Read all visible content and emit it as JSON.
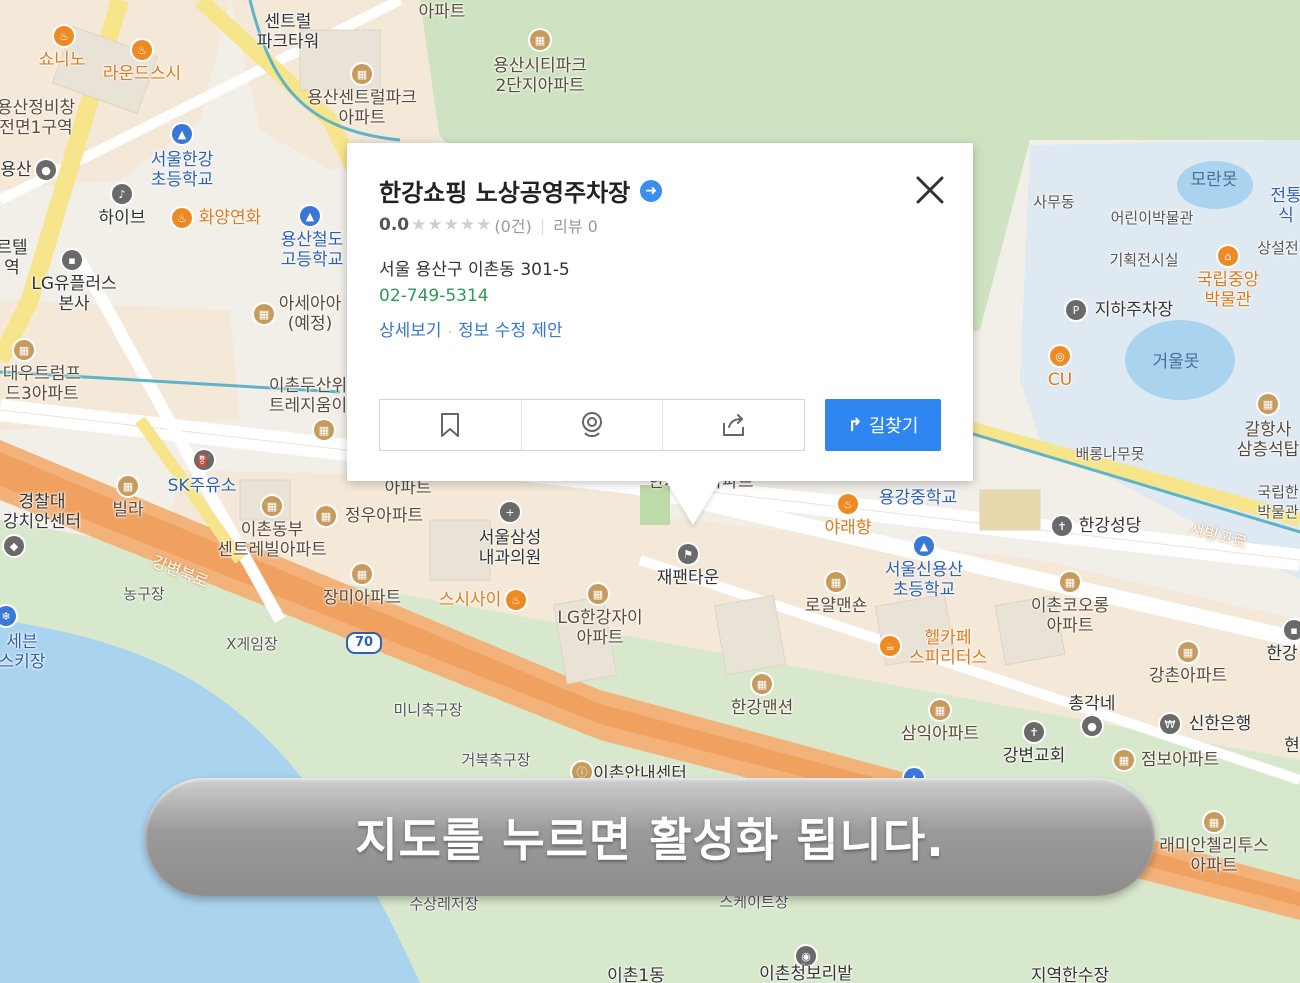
{
  "popup": {
    "title": "한강쇼핑 노상공영주차장",
    "rating_score": "0.0",
    "rating_stars": "★★★★★",
    "rating_count": "(0건)",
    "review_text": "리뷰 0",
    "address": "서울 용산구 이촌동 301-5",
    "phone": "02-749-5314",
    "link_detail": "상세보기",
    "link_separator": ".",
    "link_edit": "정보 수정 제안",
    "route_label": "길찾기",
    "icons": [
      "bookmark-icon",
      "roadview-icon",
      "share-icon",
      "route-arrow-icon",
      "close-icon",
      "go-arrow-icon"
    ],
    "accent_color": "#2f86f0",
    "phone_color": "#2d9a58"
  },
  "banner": {
    "text": "지도를 누르면 활성화 됩니다."
  },
  "map": {
    "highway_number": "70",
    "labels": [
      {
        "text": "센트럴\n파크타워",
        "style": ""
      },
      {
        "text": "아파트",
        "style": "poi-brown"
      },
      {
        "text": "쇼니노",
        "style": "poi-orange"
      },
      {
        "text": "라운드스시",
        "style": "poi-orange"
      },
      {
        "text": "용산시티파크\n2단지아파트",
        "style": "poi-brown"
      },
      {
        "text": "용산센트럴파크\n아파트",
        "style": "poi-brown"
      },
      {
        "text": "용산정비창\n전면1구역",
        "style": "poi-brown"
      },
      {
        "text": "서울한강\n초등학교",
        "style": "poi-blue"
      },
      {
        "text": "용산",
        "style": ""
      },
      {
        "text": "하이브",
        "style": ""
      },
      {
        "text": "화양연화",
        "style": "poi-orange"
      },
      {
        "text": "용산철도\n고등학교",
        "style": "poi-blue"
      },
      {
        "text": "LG유플러스\n본사",
        "style": ""
      },
      {
        "text": "르텔\n역",
        "style": ""
      },
      {
        "text": "아세아아\n(예정)",
        "style": "poi-brown"
      },
      {
        "text": "대우트럼프\n드3아파트",
        "style": "poi-brown"
      },
      {
        "text": "이촌두산위\n트레지움이",
        "style": "poi-brown"
      },
      {
        "text": "SK주유소",
        "style": "poi-blue"
      },
      {
        "text": "빌라",
        "style": "poi-brown"
      },
      {
        "text": "경찰대\n강치안센터",
        "style": ""
      },
      {
        "text": "이촌동부\n센트레빌아파트",
        "style": "poi-brown"
      },
      {
        "text": "정우아파트",
        "style": "poi-brown"
      },
      {
        "text": "아파트",
        "style": "poi-brown"
      },
      {
        "text": "서울삼성\n내과의원",
        "style": ""
      },
      {
        "text": "강변북로",
        "style": "road"
      },
      {
        "text": "농구장",
        "style": "small"
      },
      {
        "text": "장미아파트",
        "style": "poi-brown"
      },
      {
        "text": "스시사이",
        "style": "poi-orange"
      },
      {
        "text": "LG한강자이\n아파트",
        "style": "poi-brown"
      },
      {
        "text": "재팬타운",
        "style": ""
      },
      {
        "text": "로얄맨숀",
        "style": "poi-brown"
      },
      {
        "text": "X게임장",
        "style": "small"
      },
      {
        "text": "세븐\n스키장",
        "style": "poi-blue"
      },
      {
        "text": "미니축구장",
        "style": "small"
      },
      {
        "text": "한강맨션",
        "style": "poi-brown"
      },
      {
        "text": "거북축구장",
        "style": "small"
      },
      {
        "text": "모란못",
        "style": "lake"
      },
      {
        "text": "전통\n식",
        "style": "poi-blue"
      },
      {
        "text": "사무동",
        "style": "small"
      },
      {
        "text": "어린이박물관",
        "style": "small"
      },
      {
        "text": "상설전",
        "style": "small"
      },
      {
        "text": "기획전시실",
        "style": "small"
      },
      {
        "text": "국립중앙\n박물관",
        "style": "poi-orange"
      },
      {
        "text": "지하주차장",
        "style": ""
      },
      {
        "text": "거울못",
        "style": "lake"
      },
      {
        "text": "CU",
        "style": "poi-orange"
      },
      {
        "text": "갈항사\n삼층석탑",
        "style": "poi-brown"
      },
      {
        "text": "배롱나무못",
        "style": "small"
      },
      {
        "text": "국립한\n박물관",
        "style": "small"
      },
      {
        "text": "용강중학교",
        "style": "poi-blue"
      },
      {
        "text": "야래향",
        "style": "poi-orange"
      },
      {
        "text": "한강성당",
        "style": ""
      },
      {
        "text": "서빙고로",
        "style": "road"
      },
      {
        "text": "서울신용산\n초등학교",
        "style": "poi-blue"
      },
      {
        "text": "이촌코오롱\n아파트",
        "style": "poi-brown"
      },
      {
        "text": "헬카페\n스피리터스",
        "style": "poi-orange"
      },
      {
        "text": "강촌아파트",
        "style": "poi-brown"
      },
      {
        "text": "한강",
        "style": ""
      },
      {
        "text": "총각네",
        "style": ""
      },
      {
        "text": "삼익아파트",
        "style": "poi-brown"
      },
      {
        "text": "신한은행",
        "style": ""
      },
      {
        "text": "강변교회",
        "style": ""
      },
      {
        "text": "점보아파트",
        "style": "poi-brown"
      },
      {
        "text": "현",
        "style": ""
      },
      {
        "text": "래미안첼리투스\n아파트",
        "style": "poi-brown"
      },
      {
        "text": "아파트",
        "style": "poi-brown"
      },
      {
        "text": "한가",
        "style": "poi-brown"
      },
      {
        "text": "이촌안내센터",
        "style": ""
      },
      {
        "text": "수상레저장",
        "style": "small"
      },
      {
        "text": "스케이트장",
        "style": "small"
      },
      {
        "text": "이촌청보리밭",
        "style": ""
      },
      {
        "text": "이촌1동",
        "style": ""
      },
      {
        "text": "지역한수장",
        "style": ""
      }
    ]
  }
}
